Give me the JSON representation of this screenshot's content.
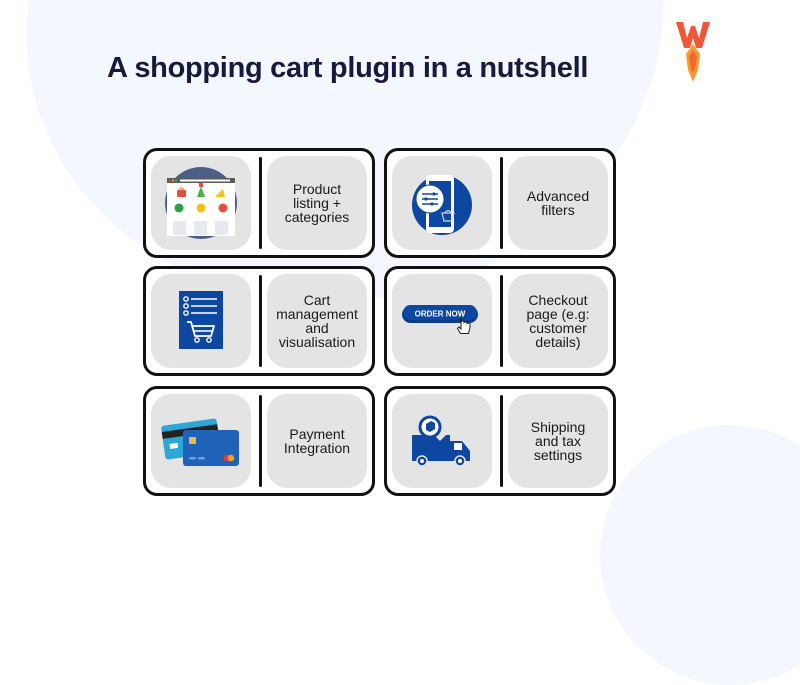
{
  "title": "A shopping cart plugin in a nutshell",
  "logo": {
    "icon": "wpmayor-w-logo-icon",
    "colors": {
      "primary": "#f0563a",
      "accent": "#f79b2e"
    }
  },
  "colors": {
    "brand_blue": "#0d47a1",
    "card_border": "#111111",
    "panel_bg": "#e4e4e4",
    "title": "#161b3d"
  },
  "cards": [
    {
      "label": "Product\nlisting +\ncategories",
      "icon": "product-listing-webpage-icon"
    },
    {
      "label": "Advanced\nfilters",
      "icon": "mobile-filter-icon"
    },
    {
      "label": "Cart\nmanagement\nand\nvisualisation",
      "icon": "cart-checklist-icon"
    },
    {
      "label": "Checkout\npage (e.g:\ncustomer\ndetails)",
      "icon": "order-now-button-icon",
      "icon_text": "ORDER NOW"
    },
    {
      "label": "Payment\nIntegration",
      "icon": "credit-cards-icon"
    },
    {
      "label": "Shipping\nand tax\nsettings",
      "icon": "delivery-truck-icon"
    }
  ]
}
